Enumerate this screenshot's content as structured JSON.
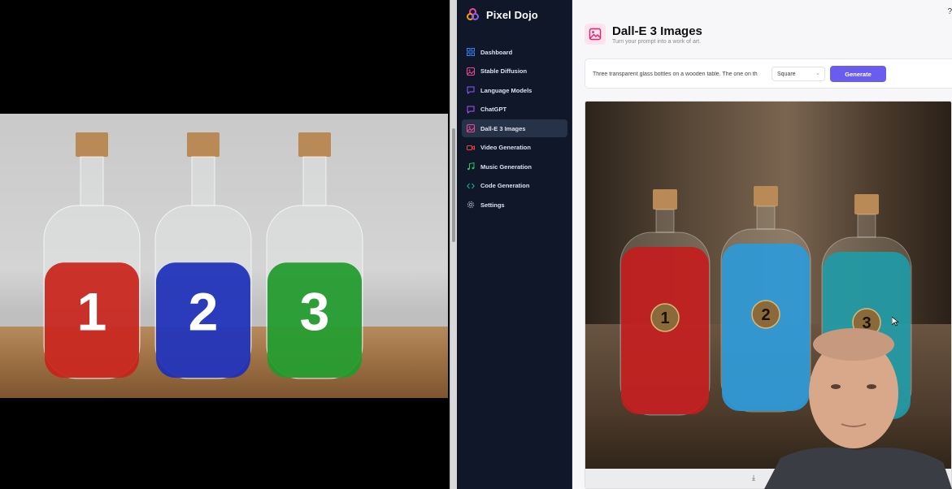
{
  "brand": {
    "name": "Pixel Dojo",
    "logo_icon": "overlapping-circles-logo"
  },
  "sidebar": {
    "items": [
      {
        "label": "Dashboard",
        "icon": "grid-icon",
        "color": "#3b82f6",
        "active": false
      },
      {
        "label": "Stable Diffusion",
        "icon": "image-frame-icon",
        "color": "#ec4899",
        "active": false
      },
      {
        "label": "Language Models",
        "icon": "chat-bubble-icon",
        "color": "#8b5cf6",
        "active": false
      },
      {
        "label": "ChatGPT",
        "icon": "chat-bubble-icon",
        "color": "#a855f7",
        "active": false
      },
      {
        "label": "Dall-E 3 Images",
        "icon": "image-frame-icon",
        "color": "#ec4899",
        "active": true
      },
      {
        "label": "Video Generation",
        "icon": "video-camera-icon",
        "color": "#ef4444",
        "active": false
      },
      {
        "label": "Music Generation",
        "icon": "music-note-icon",
        "color": "#22c55e",
        "active": false
      },
      {
        "label": "Code Generation",
        "icon": "code-brackets-icon",
        "color": "#10b981",
        "active": false
      },
      {
        "label": "Settings",
        "icon": "gear-icon",
        "color": "#9ca3af",
        "active": false
      }
    ]
  },
  "header": {
    "title": "Dall-E 3 Images",
    "subtitle": "Turn your prompt into a work of art.",
    "icon": "image-frame-icon"
  },
  "prompt": {
    "value": "Three transparent glass bottles on a wooden table. The one on th",
    "size_selected": "Square",
    "generate_label": "Generate"
  },
  "reference_image": {
    "bottles": [
      {
        "number": "1",
        "color": "#c8231a"
      },
      {
        "number": "2",
        "color": "#1c2fb8"
      },
      {
        "number": "3",
        "color": "#1f9a2a"
      }
    ]
  },
  "result_image": {
    "bottles": [
      {
        "number": "1",
        "color": "#c21d1d"
      },
      {
        "number": "2",
        "color": "#2c9ad8"
      },
      {
        "number": "3",
        "color": "#1f9aa6"
      }
    ]
  },
  "colors": {
    "sidebar_bg": "#0f1729",
    "sidebar_active": "#263247",
    "accent_button": "#6b5cf0",
    "main_bg": "#f7f7f9"
  }
}
